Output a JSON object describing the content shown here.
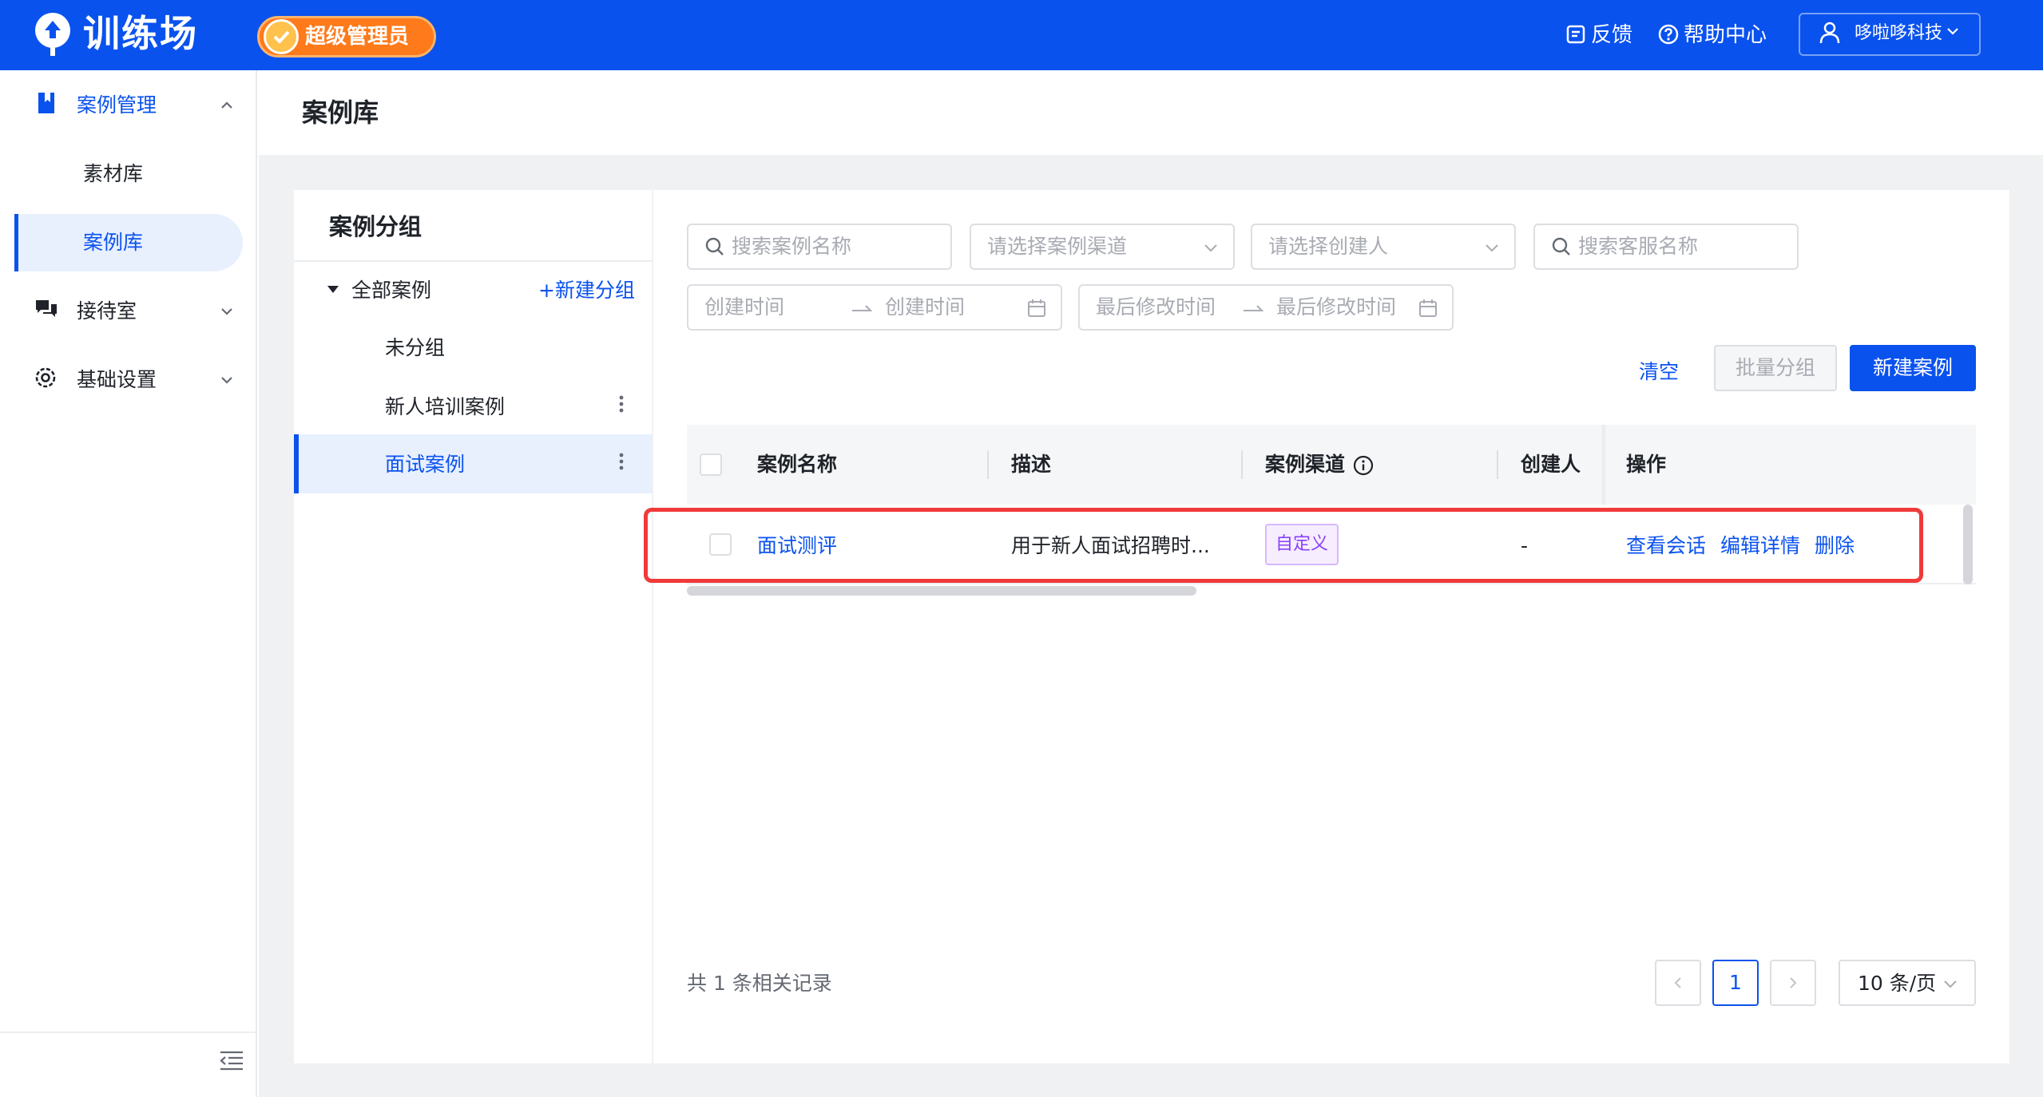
{
  "topbar": {
    "logo_text": "训练场",
    "role_badge": "超级管理员",
    "feedback": "反馈",
    "help_center": "帮助中心",
    "user_name": "哆啦哆科技"
  },
  "sidebar": {
    "case_management": "案例管理",
    "material_library": "素材库",
    "case_library": "案例库",
    "reception_room": "接待室",
    "basic_settings": "基础设置"
  },
  "page": {
    "title": "案例库"
  },
  "groups": {
    "title": "案例分组",
    "all_cases": "全部案例",
    "new_group": "+新建分组",
    "items": [
      "未分组",
      "新人培训案例",
      "面试案例"
    ]
  },
  "filters": {
    "search_case": "搜索案例名称",
    "channel": "请选择案例渠道",
    "creator": "请选择创建人",
    "search_agent": "搜索客服名称",
    "created_start": "创建时间",
    "created_end": "创建时间",
    "modified_start": "最后修改时间",
    "modified_end": "最后修改时间"
  },
  "actions": {
    "clear": "清空",
    "batch_group": "批量分组",
    "new_case": "新建案例"
  },
  "table": {
    "headers": {
      "name": "案例名称",
      "description": "描述",
      "channel": "案例渠道",
      "creator": "创建人",
      "actions": "操作"
    },
    "rows": [
      {
        "name": "面试测评",
        "description": "用于新人面试招聘时...",
        "channel_tag": "自定义",
        "creator": "-",
        "view": "查看会话",
        "edit": "编辑详情",
        "delete": "删除"
      }
    ]
  },
  "pagination": {
    "total": "共 1 条相关记录",
    "current_page": "1",
    "page_size": "10 条/页"
  },
  "colors": {
    "brand": "#0A52EE",
    "badge": "#FF7A1A",
    "highlight": "#F03A3A",
    "tag_purple": "#8A3FFC"
  }
}
